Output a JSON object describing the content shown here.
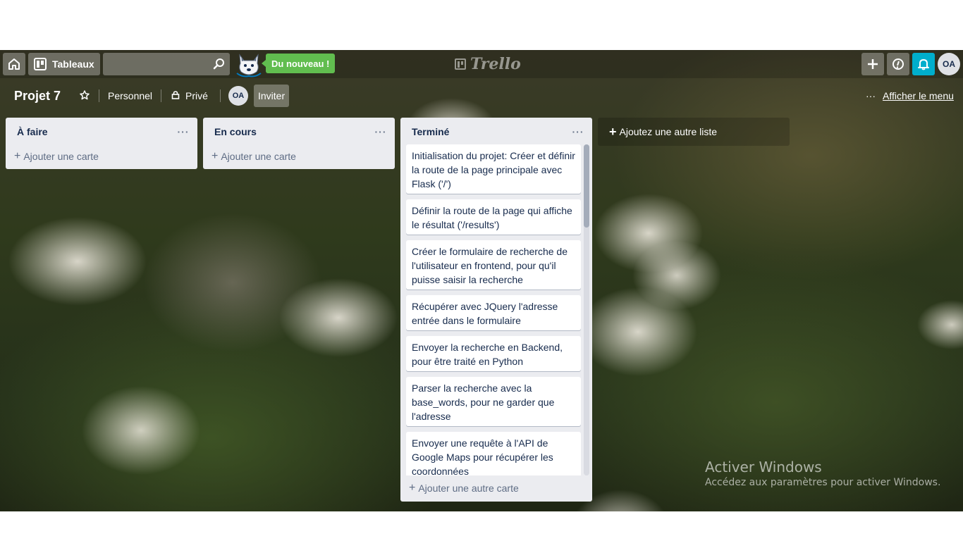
{
  "header": {
    "boards_label": "Tableaux",
    "search": {
      "value": "",
      "placeholder": ""
    },
    "whats_new_label": "Du nouveau !",
    "logo_text": "Trello",
    "user_initials": "OA",
    "icons": [
      "home-icon",
      "board-icon",
      "search-icon",
      "plus-icon",
      "info-icon",
      "bell-icon"
    ]
  },
  "board": {
    "title": "Projet 7",
    "team_label": "Personnel",
    "visibility_label": "Privé",
    "member_initials": "OA",
    "invite_label": "Inviter",
    "menu_dots": "···",
    "menu_label": "Afficher le menu"
  },
  "lists": [
    {
      "title": "À faire",
      "menu": "···",
      "add_card_label": "Ajouter une carte",
      "cards": []
    },
    {
      "title": "En cours",
      "menu": "···",
      "add_card_label": "Ajouter une carte",
      "cards": []
    },
    {
      "title": "Terminé",
      "menu": "···",
      "add_card_label": "Ajouter une autre carte",
      "cards": [
        "Initialisation du projet: Créer et définir la route de la page principale avec Flask ('/')",
        "Définir la route de la page qui affiche le résultat ('/results')",
        "Créer le formulaire de recherche de l'utilisateur en frontend, pour qu'il puisse saisir la recherche",
        "Récupérer avec JQuery l'adresse entrée dans le formulaire",
        "Envoyer la recherche en Backend, pour être traité en Python",
        "Parser la recherche avec la base_words, pour ne garder que l'adresse",
        "Envoyer une requête à l'API de Google Maps pour récupérer les coordonnées"
      ]
    }
  ],
  "add_list_label": "Ajoutez une autre liste",
  "plus_sign": "+",
  "watermark": {
    "title": "Activer Windows",
    "subtitle": "Accédez aux paramètres pour activer Windows."
  },
  "colors": {
    "accent_green": "#61bd4f",
    "notification_blue": "#00aecc",
    "list_bg": "#ebecf0"
  }
}
